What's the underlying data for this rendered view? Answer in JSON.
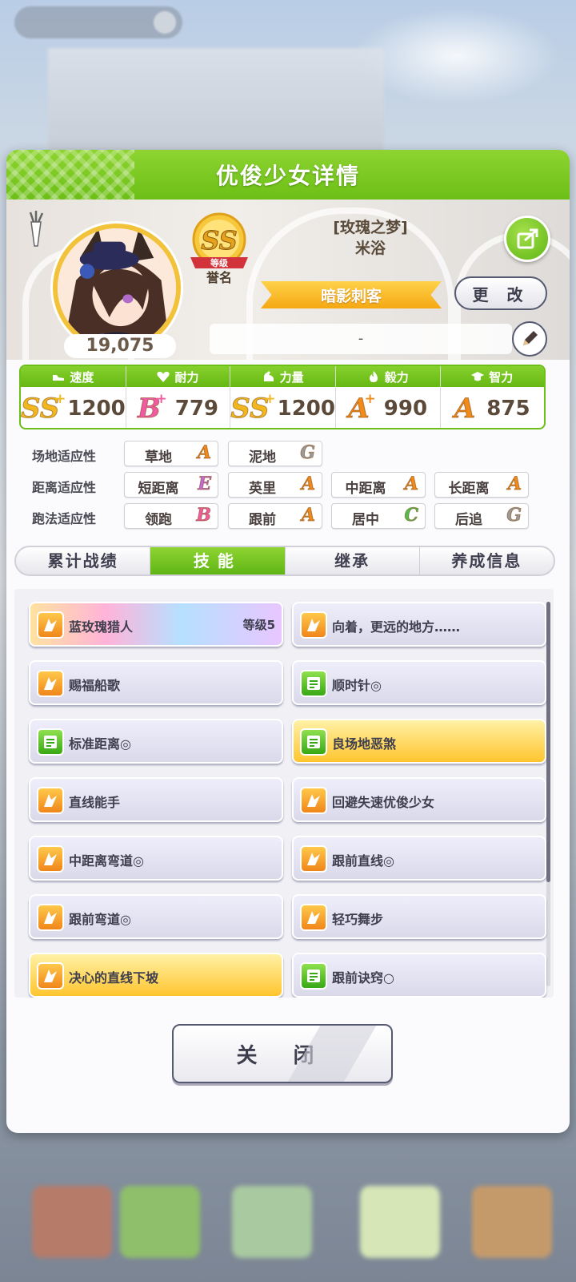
{
  "modal": {
    "title": "优俊少女详情"
  },
  "profile": {
    "fans": "19,075",
    "rank_grade": "SS",
    "rank_tag": "等级",
    "rank_label": "誉名",
    "epithet": "[玫瑰之梦]",
    "name": "米浴",
    "title": "暗影刺客",
    "change_label": "更 改",
    "comment": "-"
  },
  "stats": [
    {
      "label": "速度",
      "icon": "shoe-icon",
      "grade": "SS",
      "plus": "+",
      "value": "1200"
    },
    {
      "label": "耐力",
      "icon": "heart-icon",
      "grade": "B",
      "plus": "+",
      "value": "779"
    },
    {
      "label": "力量",
      "icon": "muscle-icon",
      "grade": "SS",
      "plus": "+",
      "value": "1200"
    },
    {
      "label": "毅力",
      "icon": "fire-icon",
      "grade": "A",
      "plus": "+",
      "value": "990"
    },
    {
      "label": "智力",
      "icon": "graduation-cap-icon",
      "grade": "A",
      "plus": "",
      "value": "875"
    }
  ],
  "aptitude": {
    "track": {
      "label": "场地适应性",
      "items": [
        {
          "name": "草地",
          "grade": "A"
        },
        {
          "name": "泥地",
          "grade": "G"
        }
      ]
    },
    "distance": {
      "label": "距离适应性",
      "items": [
        {
          "name": "短距离",
          "grade": "E"
        },
        {
          "name": "英里",
          "grade": "A"
        },
        {
          "name": "中距离",
          "grade": "A"
        },
        {
          "name": "长距离",
          "grade": "A"
        }
      ]
    },
    "style": {
      "label": "跑法适应性",
      "items": [
        {
          "name": "领跑",
          "grade": "B"
        },
        {
          "name": "跟前",
          "grade": "A"
        },
        {
          "name": "居中",
          "grade": "C"
        },
        {
          "name": "后追",
          "grade": "G"
        }
      ]
    }
  },
  "tabs": [
    "累计战绩",
    "技能",
    "继承",
    "养成信息"
  ],
  "active_tab": 1,
  "skills": [
    {
      "name": "蓝玫瑰猎人",
      "level": "等级5",
      "style": "rainbow",
      "icon": "orange"
    },
    {
      "name": "向着，更远的地方……",
      "level": "",
      "style": "normal",
      "icon": "orange"
    },
    {
      "name": "赐福船歌",
      "level": "",
      "style": "normal",
      "icon": "orange"
    },
    {
      "name": "顺时针◎",
      "level": "",
      "style": "normal",
      "icon": "green"
    },
    {
      "name": "标准距离◎",
      "level": "",
      "style": "normal",
      "icon": "green"
    },
    {
      "name": "良场地恶煞",
      "level": "",
      "style": "gold",
      "icon": "green"
    },
    {
      "name": "直线能手",
      "level": "",
      "style": "normal",
      "icon": "orange"
    },
    {
      "name": "回避失速优俊少女",
      "level": "",
      "style": "normal",
      "icon": "orange"
    },
    {
      "name": "中距离弯道◎",
      "level": "",
      "style": "normal",
      "icon": "orange"
    },
    {
      "name": "跟前直线◎",
      "level": "",
      "style": "normal",
      "icon": "orange"
    },
    {
      "name": "跟前弯道◎",
      "level": "",
      "style": "normal",
      "icon": "orange"
    },
    {
      "name": "轻巧舞步",
      "level": "",
      "style": "normal",
      "icon": "orange"
    },
    {
      "name": "决心的直线下坡",
      "level": "",
      "style": "gold",
      "icon": "orange"
    },
    {
      "name": "跟前诀窍○",
      "level": "",
      "style": "normal",
      "icon": "green"
    }
  ],
  "close_label": "关 闭",
  "colors": {
    "accent_green": "#6cbf16",
    "gold": "#f2c23a",
    "text": "#3e3e4e"
  }
}
